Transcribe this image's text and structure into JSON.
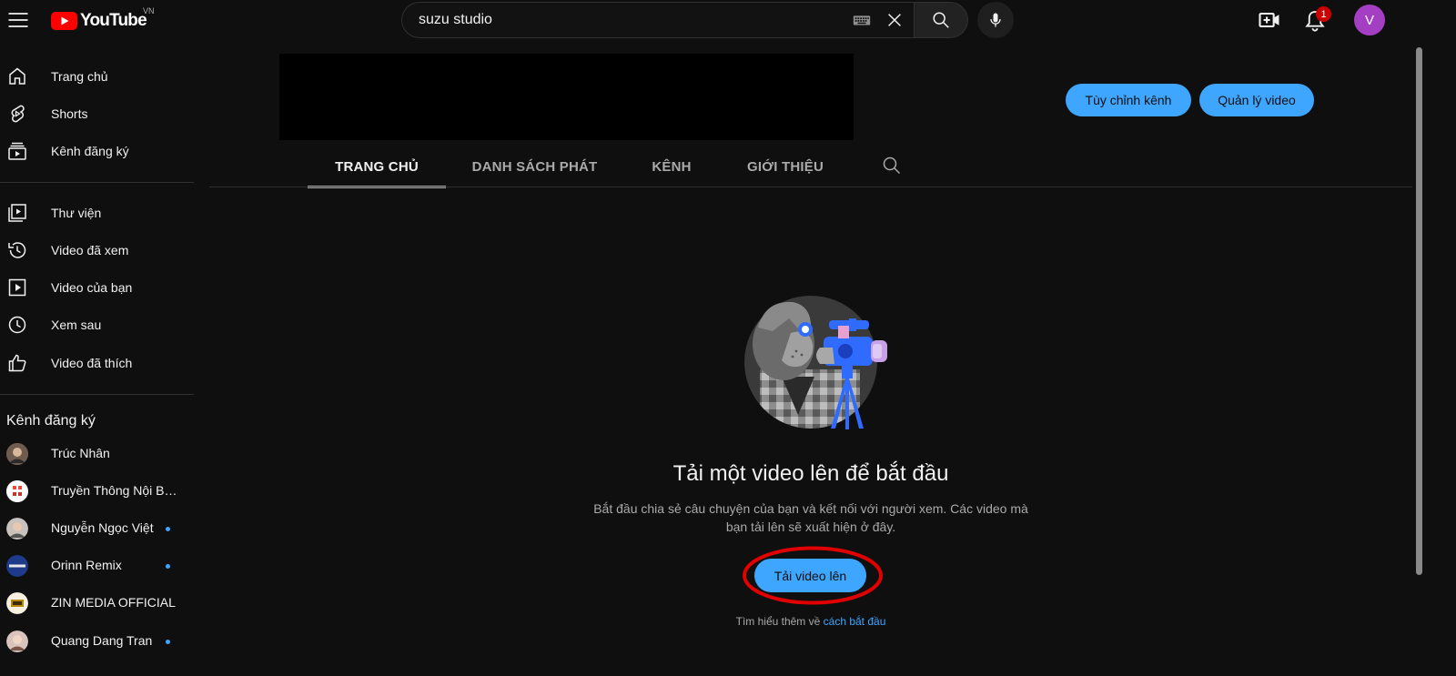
{
  "header": {
    "logo_text": "YouTube",
    "country_code": "VN",
    "search_value": "suzu studio",
    "notification_count": "1",
    "avatar_letter": "V"
  },
  "sidebar": {
    "main_items": [
      {
        "label": "Trang chủ",
        "icon": "home-icon"
      },
      {
        "label": "Shorts",
        "icon": "shorts-icon"
      },
      {
        "label": "Kênh đăng ký",
        "icon": "subscriptions-icon"
      }
    ],
    "library_items": [
      {
        "label": "Thư viện",
        "icon": "library-icon"
      },
      {
        "label": "Video đã xem",
        "icon": "history-icon"
      },
      {
        "label": "Video của bạn",
        "icon": "your-videos-icon"
      },
      {
        "label": "Xem sau",
        "icon": "watch-later-icon"
      },
      {
        "label": "Video đã thích",
        "icon": "like-icon"
      }
    ],
    "subscriptions_title": "Kênh đăng ký",
    "subscriptions": [
      {
        "name": "Trúc Nhân",
        "new": false
      },
      {
        "name": "Truyền Thông Nội Bộ SUZU",
        "new": false
      },
      {
        "name": "Nguyễn Ngọc Việt",
        "new": true
      },
      {
        "name": "Orinn Remix",
        "new": true
      },
      {
        "name": "ZIN MEDIA OFFICIAL",
        "new": false
      },
      {
        "name": "Quang Dang Tran",
        "new": true
      }
    ]
  },
  "channel": {
    "customize_label": "Tùy chỉnh kênh",
    "manage_label": "Quản lý video",
    "tabs": [
      "TRANG CHỦ",
      "DANH SÁCH PHÁT",
      "KÊNH",
      "GIỚI THIỆU"
    ]
  },
  "empty_state": {
    "title": "Tải một video lên để bắt đầu",
    "description": "Bắt đầu chia sẻ câu chuyện của bạn và kết nối với người xem. Các video mà bạn tải lên sẽ xuất hiện ở đây.",
    "upload_label": "Tải video lên",
    "learn_prefix": "Tìm hiểu thêm về ",
    "learn_link": "cách bắt đầu"
  },
  "colors": {
    "accent": "#3ea6ff",
    "badge": "#cc0000",
    "avatar": "#a43fc4",
    "highlight": "#e00000"
  }
}
